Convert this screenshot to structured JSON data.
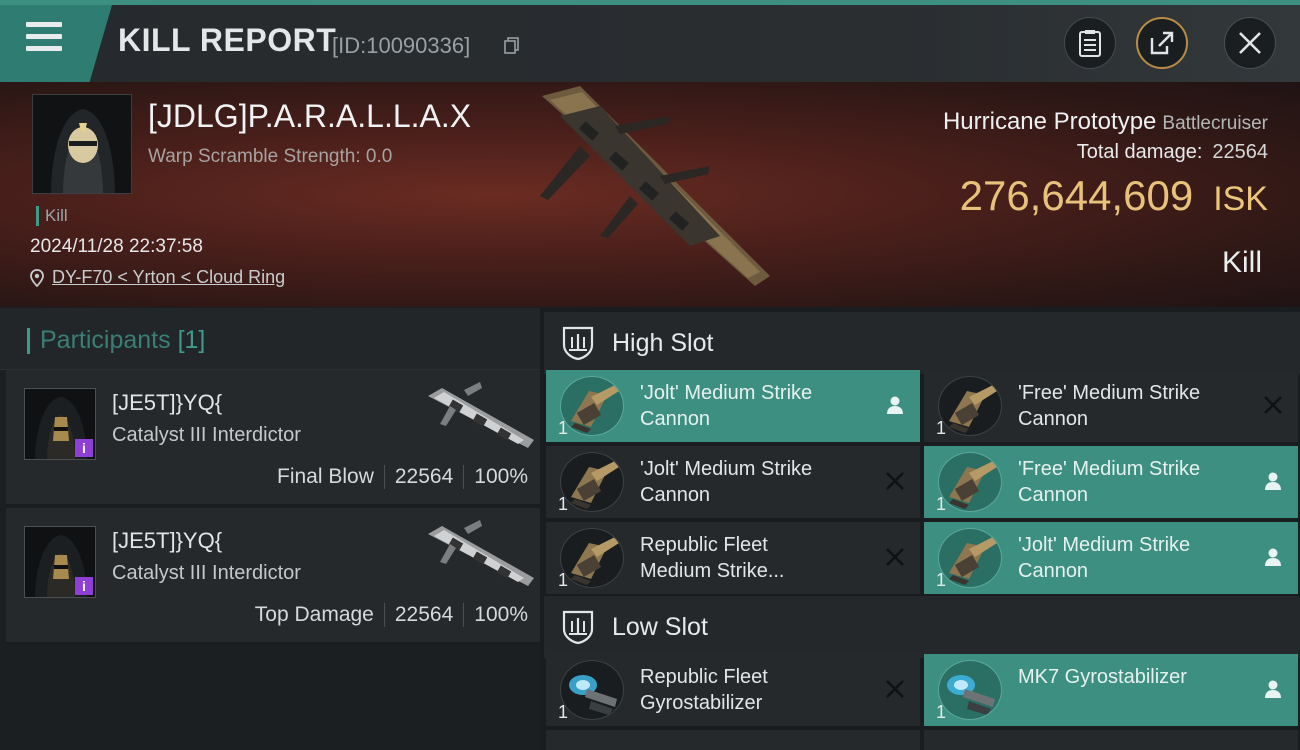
{
  "header": {
    "title": "KILL REPORT",
    "id_text": "[ID:10090336]",
    "icons": {
      "menu": "menu-icon",
      "copy": "copy-icon",
      "clipboard": "clipboard-icon",
      "share": "share-icon",
      "close": "close-icon"
    }
  },
  "victim": {
    "name": "[JDLG]P.A.R.A.L.L.A.X",
    "warp_scramble": "Warp Scramble Strength: 0.0",
    "tag": "Kill",
    "datetime": "2024/11/28 22:37:58",
    "location": "DY-F70 < Yrton < Cloud Ring",
    "ship_name": "Hurricane Prototype",
    "ship_class": "Battlecruiser",
    "total_damage_label": "Total damage:",
    "total_damage": "22564",
    "isk_value": "276,644,609",
    "isk_unit": "ISK",
    "kill_type": "Kill"
  },
  "participants": {
    "title": "Participants",
    "count": "[1]",
    "rows": [
      {
        "name": "[JE5T]}YQ{",
        "ship": "Catalyst III Interdictor",
        "role": "Final Blow",
        "damage": "22564",
        "percent": "100%",
        "badge": "i"
      },
      {
        "name": "[JE5T]}YQ{",
        "ship": "Catalyst III Interdictor",
        "role": "Top Damage",
        "damage": "22564",
        "percent": "100%",
        "badge": "i"
      }
    ]
  },
  "high_slot": {
    "title": "High Slot",
    "modules": [
      {
        "name": "'Jolt' Medium Strike\nCannon",
        "qty": "1",
        "state": "person-icon",
        "active": true
      },
      {
        "name": "'Free' Medium Strike\nCannon",
        "qty": "1",
        "state": "x-icon",
        "active": false
      },
      {
        "name": "'Jolt' Medium Strike\nCannon",
        "qty": "1",
        "state": "x-icon",
        "active": false
      },
      {
        "name": "'Free' Medium Strike\nCannon",
        "qty": "1",
        "state": "person-icon",
        "active": true
      },
      {
        "name": "Republic Fleet\nMedium Strike...",
        "qty": "1",
        "state": "x-icon",
        "active": false
      },
      {
        "name": "'Jolt' Medium Strike\nCannon",
        "qty": "1",
        "state": "person-icon",
        "active": true
      }
    ]
  },
  "low_slot": {
    "title": "Low Slot",
    "modules": [
      {
        "name": "Republic Fleet\nGyrostabilizer",
        "qty": "1",
        "state": "x-icon",
        "active": false
      },
      {
        "name": "MK7 Gyrostabilizer",
        "qty": "1",
        "state": "person-icon",
        "active": true
      }
    ]
  },
  "colors": {
    "accent": "#3d8f82",
    "isk": "#e8c27a",
    "banner": "#4a1f1b",
    "badge": "#8f3fd6"
  }
}
